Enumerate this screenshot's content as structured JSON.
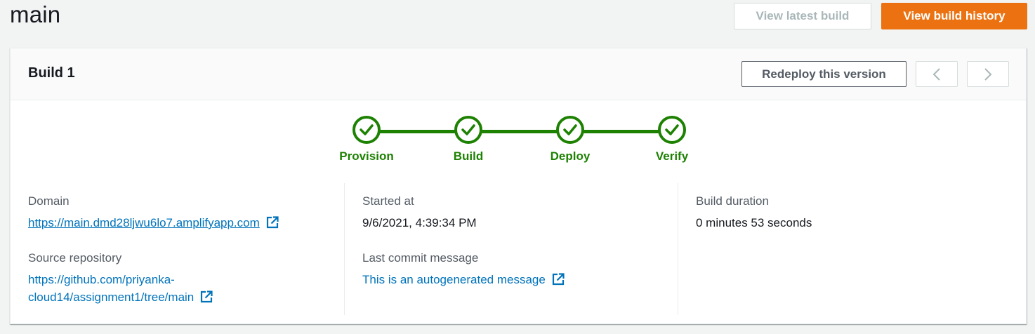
{
  "header": {
    "title": "main",
    "view_latest_build": "View latest build",
    "view_build_history": "View build history"
  },
  "card": {
    "title": "Build 1",
    "redeploy_label": "Redeploy this version"
  },
  "steps": [
    {
      "label": "Provision",
      "status": "complete"
    },
    {
      "label": "Build",
      "status": "complete"
    },
    {
      "label": "Deploy",
      "status": "complete"
    },
    {
      "label": "Verify",
      "status": "complete"
    }
  ],
  "details": {
    "domain_label": "Domain",
    "domain_value": "https://main.dmd28ljwu6lo7.amplifyapp.com",
    "source_label": "Source repository",
    "source_value_line1": "https://github.com/priyanka-",
    "source_value_line2": "cloud14/assignment1/tree/main",
    "started_label": "Started at",
    "started_value": "9/6/2021, 4:39:34 PM",
    "commit_label": "Last commit message",
    "commit_value": "This is an autogenerated message",
    "duration_label": "Build duration",
    "duration_value": "0 minutes 53 seconds"
  },
  "colors": {
    "primary": "#ec7211",
    "success": "#1d8102",
    "link": "#0073bb"
  },
  "icons": [
    "check-icon",
    "external-link-icon",
    "chevron-left-icon",
    "chevron-right-icon"
  ]
}
